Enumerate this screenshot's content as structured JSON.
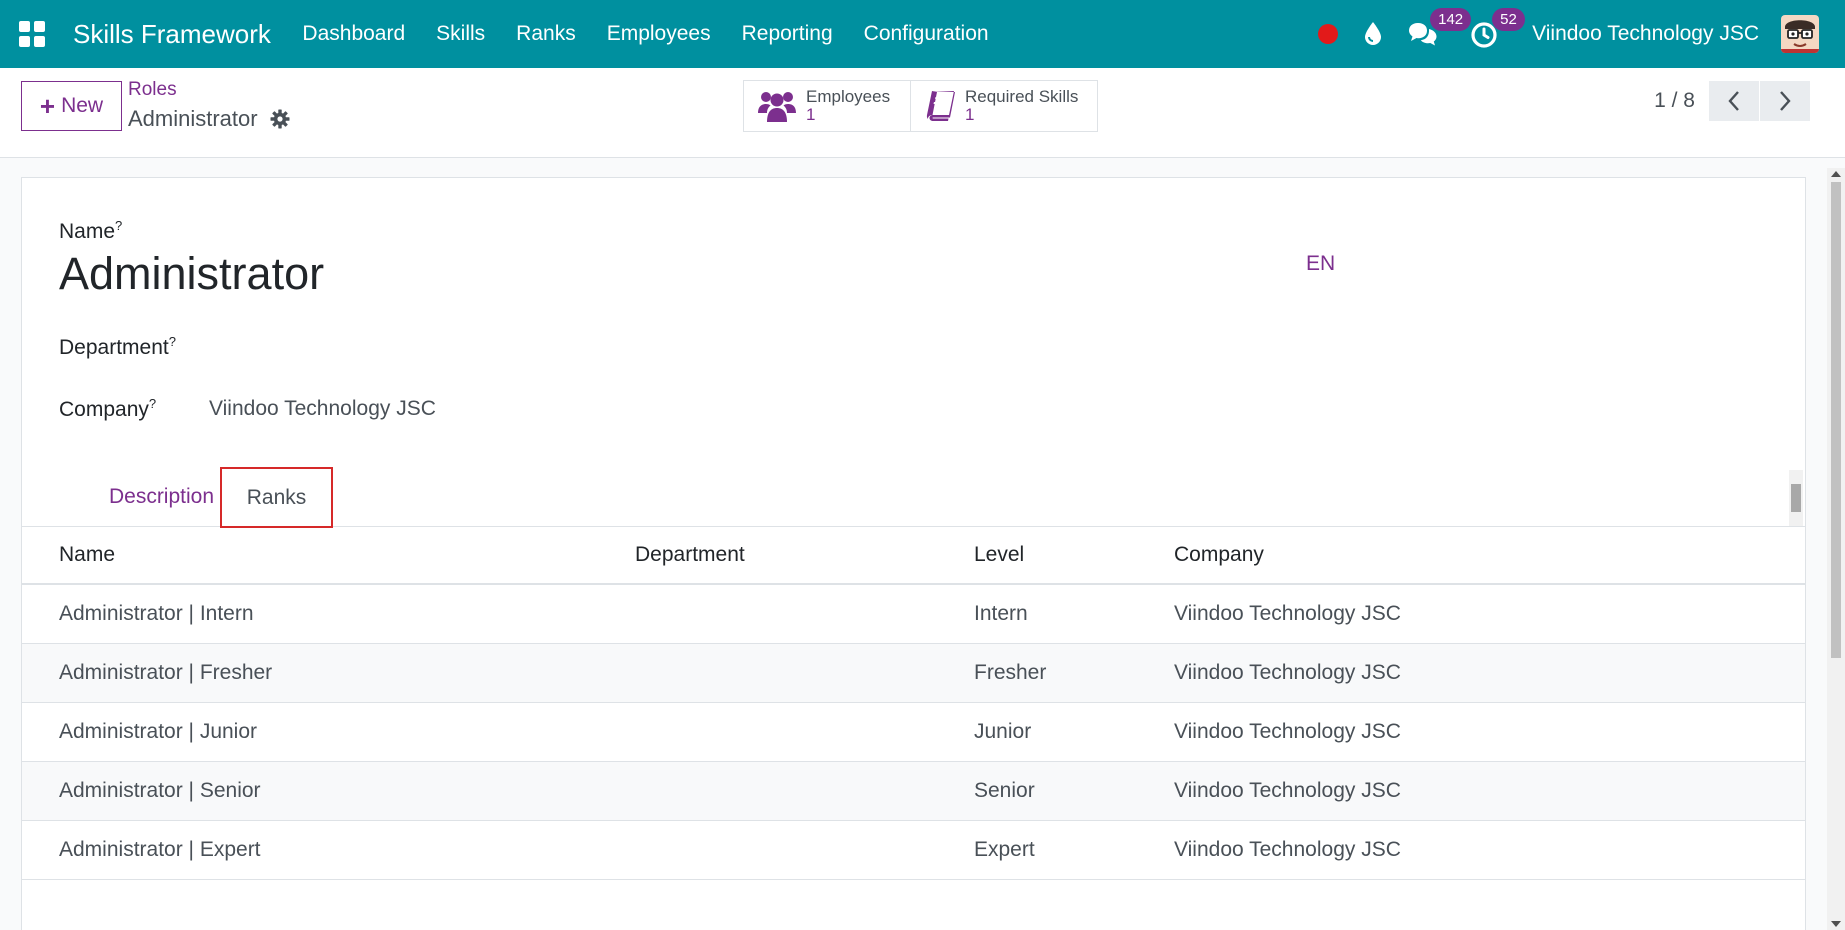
{
  "navbar": {
    "brand": "Skills Framework",
    "menu": [
      "Dashboard",
      "Skills",
      "Ranks",
      "Employees",
      "Reporting",
      "Configuration"
    ],
    "messages_count": "142",
    "activities_count": "52",
    "company": "Viindoo Technology JSC",
    "color": "#00909f"
  },
  "control": {
    "new_label": "New",
    "breadcrumb_parent": "Roles",
    "breadcrumb_current": "Administrator",
    "smart_buttons": [
      {
        "label": "Employees",
        "value": "1",
        "icon": "users-icon"
      },
      {
        "label": "Required Skills",
        "value": "1",
        "icon": "book-icon"
      }
    ],
    "pager": "1 / 8"
  },
  "form": {
    "name_label": "Name",
    "help_mark": "?",
    "name_value": "Administrator",
    "lang": "EN",
    "department_label": "Department",
    "company_label": "Company",
    "company_value": "Viindoo Technology JSC",
    "tabs": [
      "Description",
      "Ranks"
    ],
    "active_tab": "Ranks"
  },
  "table": {
    "headers": [
      "Name",
      "Department",
      "Level",
      "Company"
    ],
    "rows": [
      {
        "name": "Administrator | Intern",
        "department": "",
        "level": "Intern",
        "company": "Viindoo Technology JSC"
      },
      {
        "name": "Administrator | Fresher",
        "department": "",
        "level": "Fresher",
        "company": "Viindoo Technology JSC"
      },
      {
        "name": "Administrator | Junior",
        "department": "",
        "level": "Junior",
        "company": "Viindoo Technology JSC"
      },
      {
        "name": "Administrator | Senior",
        "department": "",
        "level": "Senior",
        "company": "Viindoo Technology JSC"
      },
      {
        "name": "Administrator | Expert",
        "department": "",
        "level": "Expert",
        "company": "Viindoo Technology JSC"
      }
    ]
  },
  "colors": {
    "primary": "#7c2f8e",
    "highlight": "#d62929"
  }
}
